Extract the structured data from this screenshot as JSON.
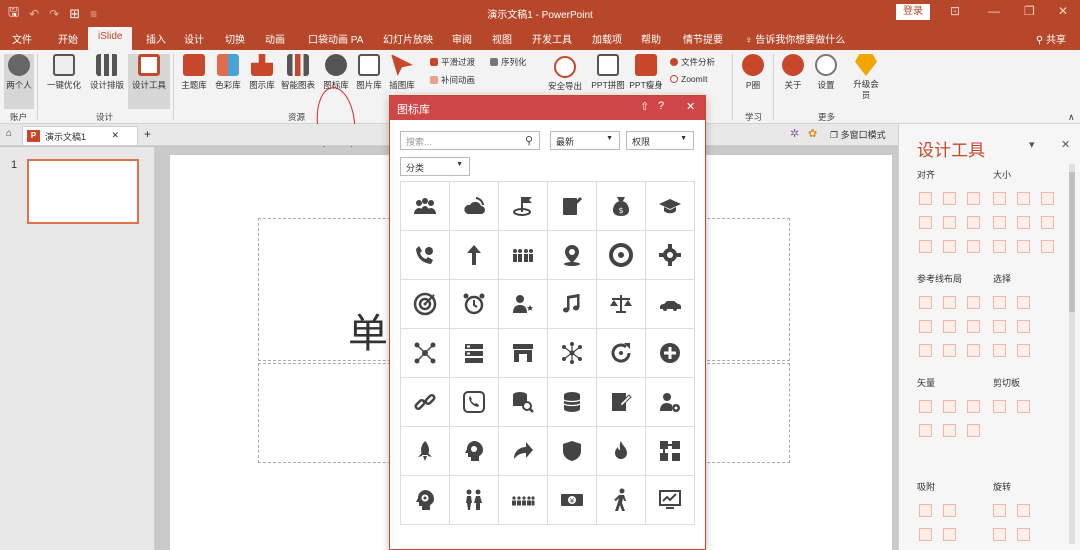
{
  "window": {
    "title": "演示文稿1 - PowerPoint",
    "login_label": "登录",
    "share_label": "共享",
    "tell_me": "告诉我你想要做什么"
  },
  "tabs": [
    "文件",
    "开始",
    "iSlide",
    "插入",
    "设计",
    "切换",
    "动画",
    "口袋动画 PA",
    "幻灯片放映",
    "审阅",
    "视图",
    "开发工具",
    "加载项",
    "帮助",
    "情节提要"
  ],
  "active_tab": "iSlide",
  "ribbon": {
    "account_btn": "两个人",
    "groups": {
      "account": "账户",
      "design": "设计",
      "resources": "资源",
      "learn": "学习",
      "more": "更多"
    },
    "design_buttons": [
      "一键优化",
      "设计排版",
      "设计工具"
    ],
    "resource_buttons": [
      "主题库",
      "色彩库",
      "图示库",
      "智能图表",
      "图标库",
      "图片库",
      "插图库"
    ],
    "anim_small": [
      "平滑过渡",
      "补间动画"
    ],
    "serialize": "序列化",
    "tools_buttons": [
      "安全导出",
      "PPT拼图",
      "PPT瘦身"
    ],
    "analysis_small": [
      "文件分析",
      "ZoomIt"
    ],
    "learn_buttons": [
      "P圈"
    ],
    "more_buttons": [
      "关于",
      "设置",
      "升级会员"
    ]
  },
  "doc": {
    "tab_name": "演示文稿1",
    "multi_window": "多窗口模式",
    "slide_number": "1",
    "slide_text": "单"
  },
  "icon_library": {
    "title": "图标库",
    "search_placeholder": "搜索...",
    "sort_value": "最新",
    "permission_value": "权限",
    "category_value": "分类",
    "icons": [
      "group-users-icon",
      "cloud-wifi-icon",
      "flag-pin-icon",
      "edit-document-icon",
      "money-bag-icon",
      "graduation-cap-icon",
      "phone-call-icon",
      "up-arrow-icon",
      "crowd-icon",
      "location-pin-icon",
      "aperture-icon",
      "gear-icon",
      "target-icon",
      "alarm-clock-icon",
      "user-star-icon",
      "music-note-icon",
      "scales-icon",
      "car-icon",
      "network-people-icon",
      "server-icon",
      "storefront-icon",
      "nodes-icon",
      "refresh-icon",
      "plus-circle-icon",
      "link-icon",
      "phone-frame-icon",
      "database-search-icon",
      "coins-icon",
      "write-note-icon",
      "user-settings-icon",
      "rocket-icon",
      "head-lightbulb-icon",
      "forward-arrow-icon",
      "shield-icon",
      "flame-icon",
      "puzzle-blocks-icon",
      "head-gear-icon",
      "two-people-icon",
      "crowd-row-icon",
      "dollar-bill-icon",
      "walking-person-icon",
      "chart-monitor-icon"
    ]
  },
  "design_panel": {
    "title": "设计工具",
    "sections": [
      "对齐",
      "大小",
      "参考线布局",
      "选择",
      "矢量",
      "剪切板",
      "吸附",
      "旋转"
    ]
  },
  "colors": {
    "accent": "#b7472a",
    "dialog_header": "#cf4646",
    "icon_fill": "#444444",
    "annotation_red": "#d4281c"
  }
}
